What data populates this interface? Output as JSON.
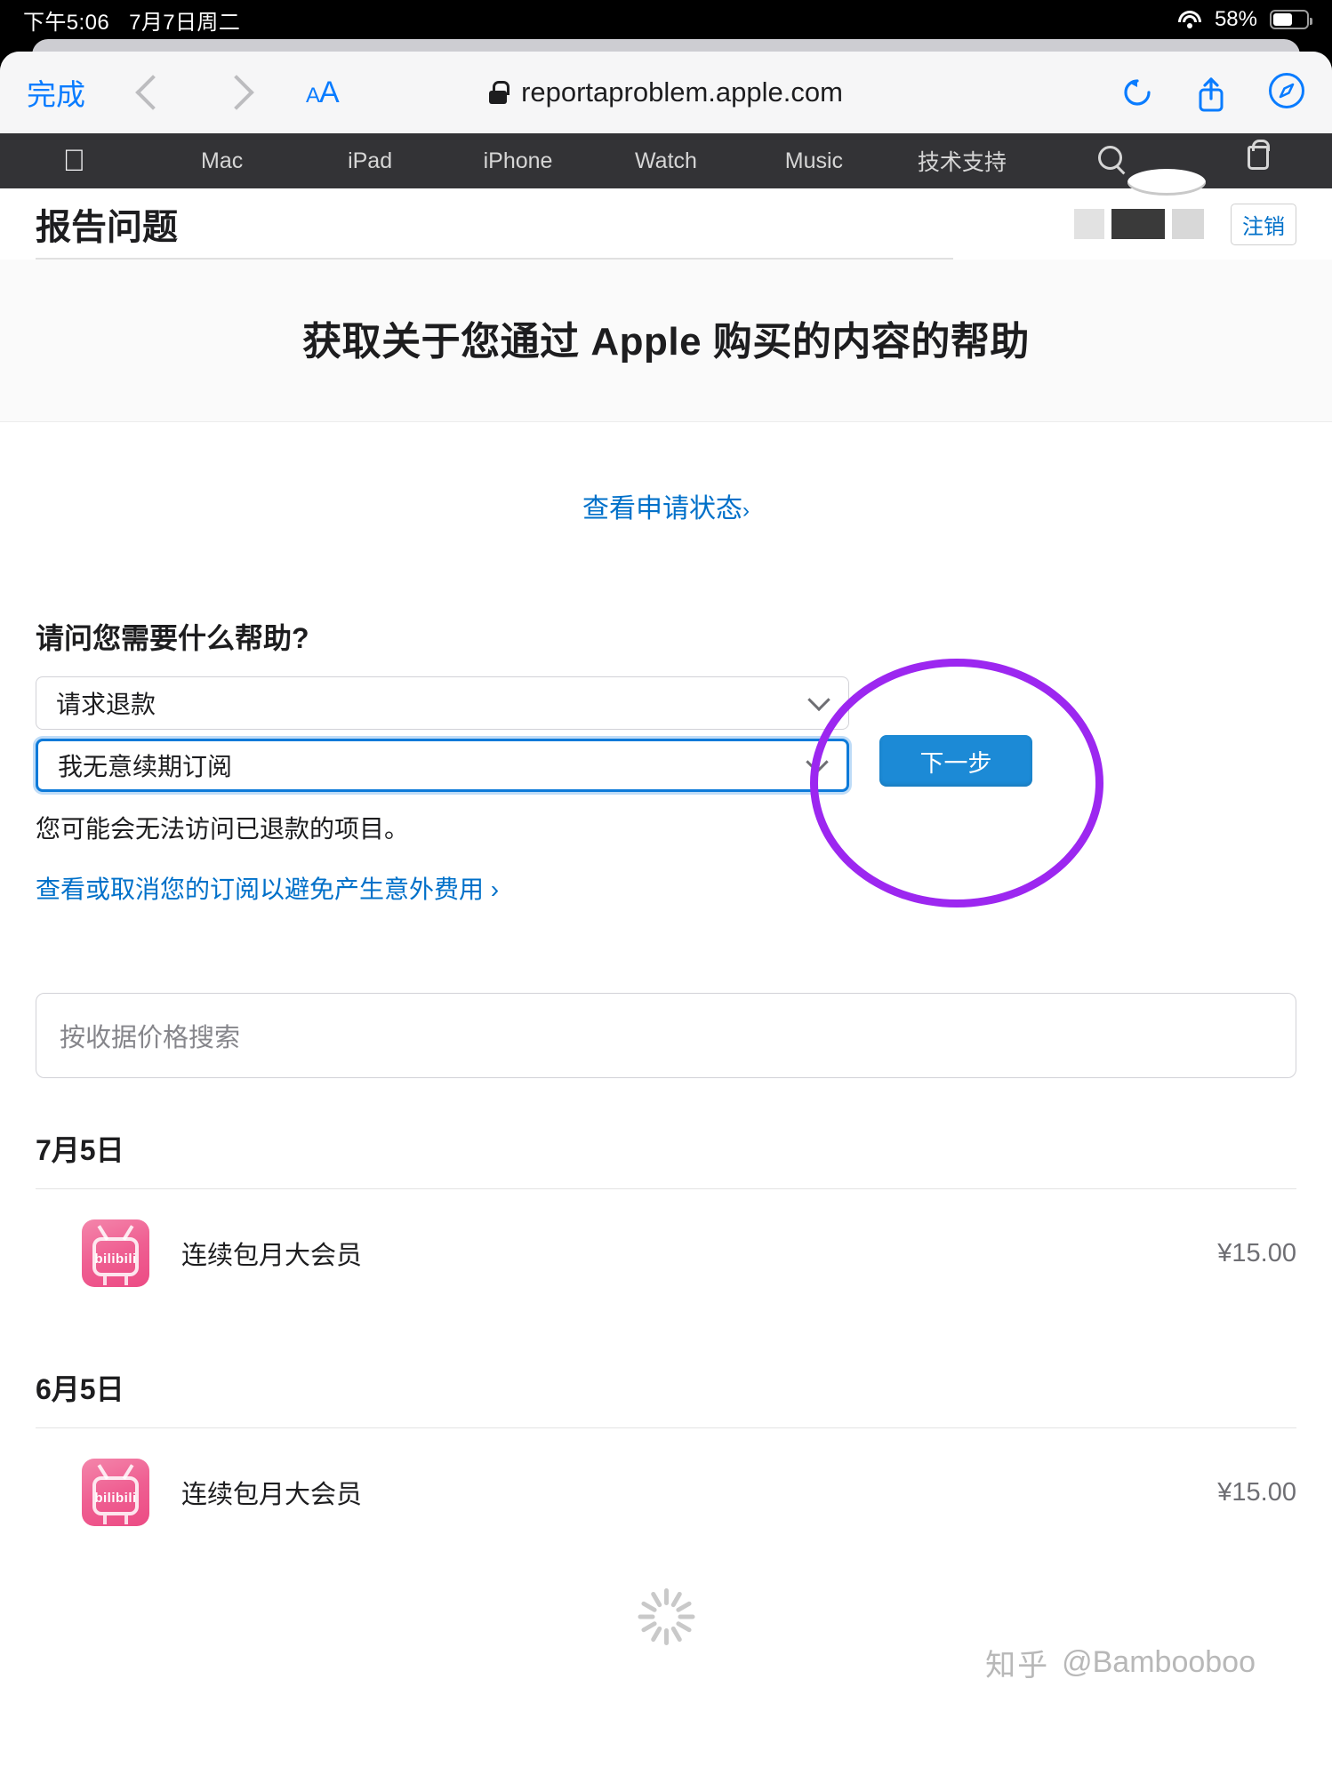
{
  "statusbar": {
    "time": "下午5:06",
    "date": "7月7日周二",
    "battery_percent": "58%",
    "wifi_icon": "wifi-icon",
    "battery_icon": "battery-icon"
  },
  "browser": {
    "done_label": "完成",
    "back_icon": "chevron-left-icon",
    "forward_icon": "chevron-right-icon",
    "text_size_small": "A",
    "text_size_large": "A",
    "lock_icon": "lock-icon",
    "url": "reportaproblem.apple.com",
    "reload_icon": "reload-icon",
    "share_icon": "share-icon",
    "tabs_icon": "compass-icon"
  },
  "globalnav": {
    "apple_logo": "",
    "items": [
      {
        "label": "Mac"
      },
      {
        "label": "iPad"
      },
      {
        "label": "iPhone"
      },
      {
        "label": "Watch"
      },
      {
        "label": "Music"
      },
      {
        "label": "技术支持"
      }
    ],
    "search_icon": "search-icon",
    "bag_icon": "shopping-bag-icon"
  },
  "page": {
    "title": "报告问题",
    "signout_label": "注销",
    "hero_title": "获取关于您通过 Apple 购买的内容的帮助",
    "status_link": "查看申请状态",
    "status_link_chevron": "›"
  },
  "form": {
    "question_label": "请问您需要什么帮助?",
    "select_1": {
      "value": "请求退款",
      "chevron_icon": "chevron-down-icon"
    },
    "select_2": {
      "value": "我无意续期订阅",
      "chevron_icon": "chevron-down-icon"
    },
    "next_button": "下一步",
    "hint": "您可能会无法访问已退款的项目。",
    "sublink": "查看或取消您的订阅以避免产生意外费用 ›"
  },
  "search": {
    "placeholder": "按收据价格搜索"
  },
  "purchases": [
    {
      "date": "7月5日",
      "items": [
        {
          "icon": "bilibili-app-icon",
          "icon_text": "bilibili",
          "title": "连续包月大会员",
          "price": "¥15.00"
        }
      ]
    },
    {
      "date": "6月5日",
      "items": [
        {
          "icon": "bilibili-app-icon",
          "icon_text": "bilibili",
          "title": "连续包月大会员",
          "price": "¥15.00"
        }
      ]
    }
  ],
  "footer": {
    "spinner_icon": "loading-spinner-icon",
    "watermark_site": "知乎",
    "watermark_user": "@Bambooboo"
  },
  "colors": {
    "accent_blue": "#0070c9",
    "ios_blue": "#0a7cff",
    "annotation_purple": "#9c27f0",
    "nav_dark": "#333336",
    "bilibili_pink": "#ec4b84"
  }
}
